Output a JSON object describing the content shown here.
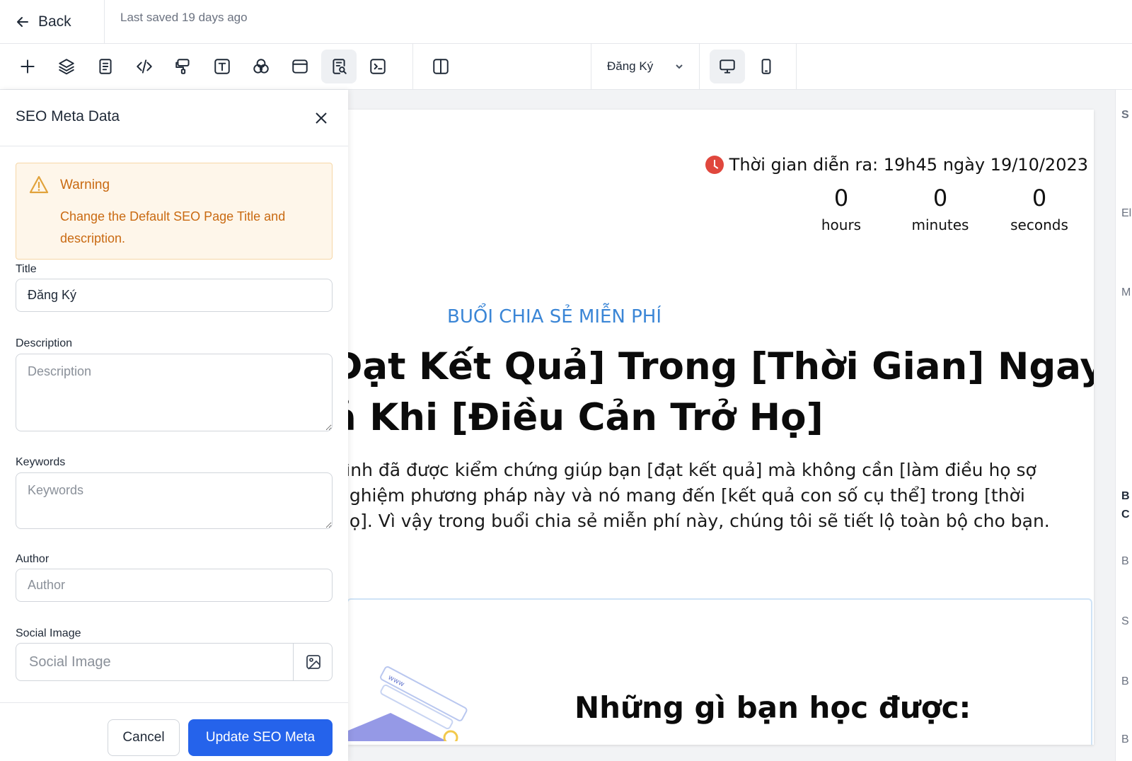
{
  "header": {
    "back_label": "Back",
    "last_saved": "Last saved 19 days ago"
  },
  "toolbar": {
    "page_selector": "Đăng Ký"
  },
  "seo_panel": {
    "title": "SEO Meta Data",
    "warning_title": "Warning",
    "warning_message": "Change the Default SEO Page Title and description.",
    "title_label": "Title",
    "title_value": "Đăng Ký",
    "description_label": "Description",
    "description_placeholder": "Description",
    "keywords_label": "Keywords",
    "keywords_placeholder": "Keywords",
    "author_label": "Author",
    "author_placeholder": "Author",
    "social_image_label": "Social Image",
    "social_image_placeholder": "Social Image",
    "cancel_label": "Cancel",
    "update_label": "Update SEO Meta"
  },
  "canvas": {
    "event_time": "Thời gian diễn ra: 19h45 ngày 19/10/2023",
    "countdown": [
      {
        "value": "0",
        "unit": "hours"
      },
      {
        "value": "0",
        "unit": "minutes"
      },
      {
        "value": "0",
        "unit": "seconds"
      }
    ],
    "subtitle": "BUỔI CHIA SẺ MIỄN PHÍ",
    "headline_line1": "Đạt Kết Quả] Trong [Thời Gian] Ngay",
    "headline_line2": "ả Khi [Điều Cản Trở Họ]",
    "body_line1": "rình đã được kiểm chứng giúp bạn [đạt kết quả] mà không cần [làm điều họ sợ",
    "body_line2": "nghiệm phương pháp này và nó mang đến [kết quả con số cụ thể] trong [thời",
    "body_line3": "họ]. Vì vậy trong buổi chia sẻ miễn phí này, chúng tôi sẽ tiết lộ toàn bộ cho bạn.",
    "learn_title": "Những gì bạn học được:",
    "illus_text": "www"
  },
  "right_panel": {
    "letters": [
      "S",
      "El",
      "M",
      "B",
      "C",
      "B",
      "S",
      "B",
      "B"
    ]
  },
  "colors": {
    "primary": "#2563eb",
    "warning_text": "#c96a12",
    "warning_bg": "#fef6ea",
    "subtitle_blue": "#3b86d6"
  }
}
